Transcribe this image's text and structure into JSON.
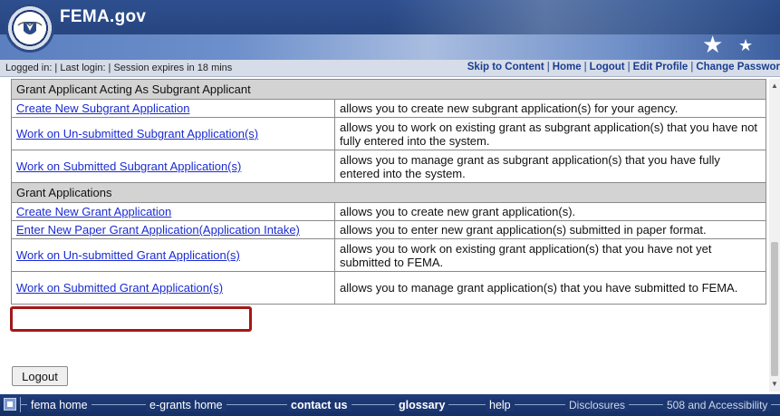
{
  "header": {
    "site_title": "FEMA.gov"
  },
  "infobar": {
    "session_text": "Logged in:  |  Last login:   |  Session expires in 18 mins",
    "links": [
      "Skip to Content",
      "Home",
      "Logout",
      "Edit Profile",
      "Change Passwor"
    ]
  },
  "sections": [
    {
      "title": "Grant Applicant Acting As Subgrant Applicant",
      "rows": [
        {
          "link": "Create New Subgrant Application",
          "desc": "allows you to create new subgrant application(s) for your agency."
        },
        {
          "link": "Work on Un-submitted Subgrant Application(s)",
          "desc": "allows you to work on existing grant as subgrant application(s) that you have not fully entered into the system."
        },
        {
          "link": "Work on Submitted Subgrant Application(s)",
          "desc": "allows you to manage grant as subgrant application(s) that you have fully entered into the system."
        }
      ]
    },
    {
      "title": "Grant Applications",
      "rows": [
        {
          "link": "Create New Grant Application",
          "desc": "allows you to create new grant application(s)."
        },
        {
          "link": "Enter New Paper Grant Application(Application Intake)",
          "desc": "allows you to enter new grant application(s) submitted in paper format."
        },
        {
          "link": "Work on Un-submitted Grant Application(s)",
          "desc": "allows you to work on existing grant application(s) that you have not yet submitted to FEMA."
        },
        {
          "link": "Work on Submitted Grant Application(s)",
          "desc": "allows you to manage grant application(s) that you have submitted to FEMA."
        }
      ]
    }
  ],
  "logout_button": "Logout",
  "footer": {
    "links": [
      "fema home",
      "e-grants home",
      "contact us",
      "glossary",
      "help",
      "Disclosures",
      "508 and Accessibility"
    ]
  },
  "colors": {
    "highlight_border": "#a31818",
    "link": "#1b2bd1",
    "section_bg": "#d3d3d3"
  }
}
